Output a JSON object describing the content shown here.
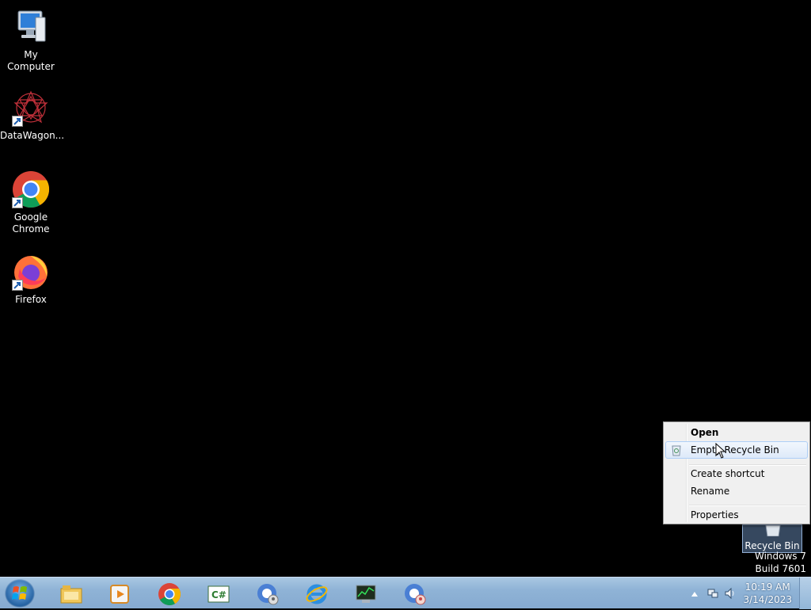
{
  "desktop": {
    "icons": [
      {
        "label": "My Computer"
      },
      {
        "label": "DataWagon..."
      },
      {
        "label": "Google Chrome"
      },
      {
        "label": "Firefox"
      }
    ],
    "recycle_bin_label": "Recycle Bin",
    "watermark": {
      "line1": "Windows 7",
      "line2": "Build 7601"
    }
  },
  "context_menu": {
    "items": [
      {
        "label": "Open"
      },
      {
        "label": "Empty Recycle Bin"
      },
      {
        "label": "Create shortcut"
      },
      {
        "label": "Rename"
      },
      {
        "label": "Properties"
      }
    ]
  },
  "taskbar": {
    "pinned": [
      {
        "icon": "file-explorer-icon"
      },
      {
        "icon": "media-player-icon"
      },
      {
        "icon": "chrome-icon"
      },
      {
        "icon": "csharp-editor-icon"
      },
      {
        "icon": "chrome-user-profile-icon"
      },
      {
        "icon": "internet-explorer-icon"
      },
      {
        "icon": "task-manager-icon"
      },
      {
        "icon": "chrome-user-profile-2-icon"
      }
    ],
    "clock": {
      "time": "10:19 AM",
      "date": "3/14/2023"
    }
  }
}
